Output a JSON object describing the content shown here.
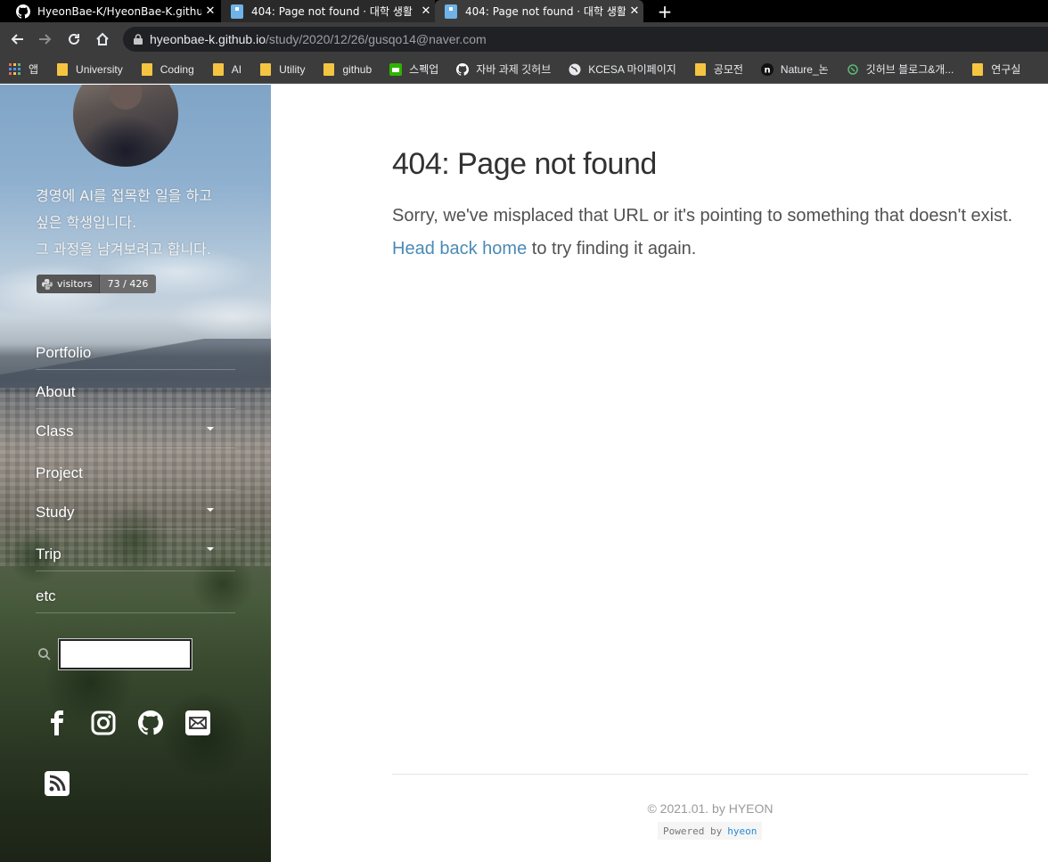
{
  "browser": {
    "tabs": [
      {
        "title": "HyeonBae-K/HyeonBae-K.github",
        "icon": "github-icon"
      },
      {
        "title": "404: Page not found · 대학 생활",
        "icon": "page-icon"
      },
      {
        "title": "404: Page not found · 대학 생활",
        "icon": "page-icon",
        "active": true
      }
    ],
    "close_glyph": "✕",
    "new_tab_glyph": "+",
    "url_host": "hyeonbae-k.github.io",
    "url_path": "/study/2020/12/26/gusqo14@naver.com",
    "bookmarks": [
      {
        "label": "앱",
        "icon": "apps-icon"
      },
      {
        "label": "University",
        "icon": "folder-icon"
      },
      {
        "label": "Coding",
        "icon": "folder-icon"
      },
      {
        "label": "AI",
        "icon": "folder-icon"
      },
      {
        "label": "Utility",
        "icon": "folder-icon"
      },
      {
        "label": "github",
        "icon": "folder-icon"
      },
      {
        "label": "스펙업",
        "icon": "speckup-icon"
      },
      {
        "label": "자바 과제 깃허브",
        "icon": "github-icon"
      },
      {
        "label": "KCESA 마이페이지",
        "icon": "globe-icon"
      },
      {
        "label": "공모전",
        "icon": "folder-icon"
      },
      {
        "label": "Nature_논",
        "icon": "notion-icon"
      },
      {
        "label": "깃허브 블로그&개...",
        "icon": "blog-icon"
      },
      {
        "label": "연구실",
        "icon": "folder-icon"
      }
    ]
  },
  "sidebar": {
    "bio": [
      "경영에 AI를 접목한 일을 하고",
      "싶은 학생입니다.",
      "그 과정을 남겨보려고 합니다."
    ],
    "badge": {
      "label": "visitors",
      "value": "73 / 426"
    },
    "nav": [
      {
        "label": "Portfolio",
        "dropdown": false
      },
      {
        "label": "About",
        "dropdown": false
      },
      {
        "label": "Class",
        "dropdown": true
      },
      {
        "label": "Project",
        "dropdown": false
      },
      {
        "label": "Study",
        "dropdown": true
      },
      {
        "label": "Trip",
        "dropdown": true
      },
      {
        "label": "etc",
        "dropdown": false
      }
    ],
    "search_value": "",
    "socials": [
      "facebook-icon",
      "instagram-icon",
      "github-icon",
      "email-icon",
      "rss-icon"
    ]
  },
  "main": {
    "title": "404: Page not found",
    "message_before": "Sorry, we've misplaced that URL or it's pointing to something that doesn't exist. ",
    "link_text": "Head back home",
    "message_after": " to try finding it again.",
    "copyright": "© 2021.01. by HYEON",
    "powered_label": "Powered by",
    "powered_link": "hyeon"
  },
  "colors": {
    "link": "#4a8ab5",
    "heading": "#313131",
    "text": "#515151"
  }
}
